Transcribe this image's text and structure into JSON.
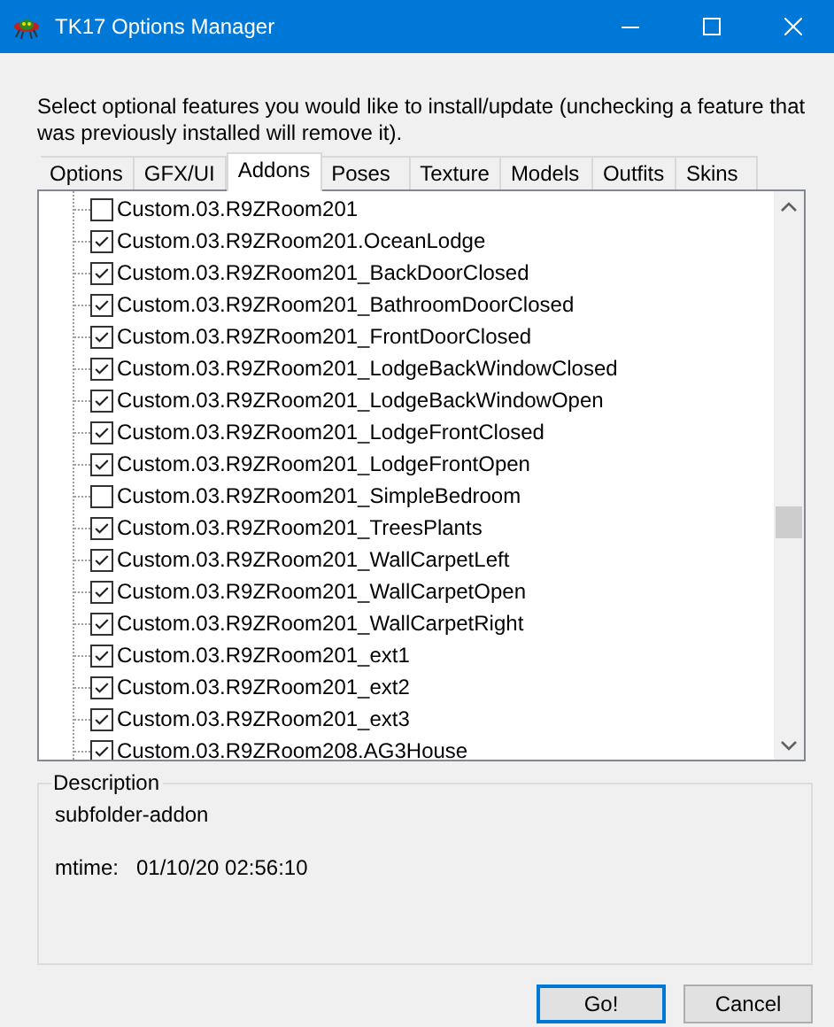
{
  "window": {
    "title": "TK17 Options Manager"
  },
  "instructions": "Select optional features you would like to install/update (unchecking a feature that was previously installed will remove it).",
  "tabs": [
    {
      "label": "Options",
      "selected": false
    },
    {
      "label": "GFX/UI",
      "selected": false
    },
    {
      "label": "Addons",
      "selected": true
    },
    {
      "label": "Poses",
      "selected": false
    },
    {
      "label": "Texture",
      "selected": false
    },
    {
      "label": "Models",
      "selected": false
    },
    {
      "label": "Outfits",
      "selected": false
    },
    {
      "label": "Skins",
      "selected": false
    }
  ],
  "tree": {
    "items": [
      {
        "label": "Custom.03.R9ZRoom201",
        "checked": false
      },
      {
        "label": "Custom.03.R9ZRoom201.OceanLodge",
        "checked": true
      },
      {
        "label": "Custom.03.R9ZRoom201_BackDoorClosed",
        "checked": true
      },
      {
        "label": "Custom.03.R9ZRoom201_BathroomDoorClosed",
        "checked": true
      },
      {
        "label": "Custom.03.R9ZRoom201_FrontDoorClosed",
        "checked": true
      },
      {
        "label": "Custom.03.R9ZRoom201_LodgeBackWindowClosed",
        "checked": true
      },
      {
        "label": "Custom.03.R9ZRoom201_LodgeBackWindowOpen",
        "checked": true
      },
      {
        "label": "Custom.03.R9ZRoom201_LodgeFrontClosed",
        "checked": true
      },
      {
        "label": "Custom.03.R9ZRoom201_LodgeFrontOpen",
        "checked": true
      },
      {
        "label": "Custom.03.R9ZRoom201_SimpleBedroom",
        "checked": false
      },
      {
        "label": "Custom.03.R9ZRoom201_TreesPlants",
        "checked": true
      },
      {
        "label": "Custom.03.R9ZRoom201_WallCarpetLeft",
        "checked": true
      },
      {
        "label": "Custom.03.R9ZRoom201_WallCarpetOpen",
        "checked": true
      },
      {
        "label": "Custom.03.R9ZRoom201_WallCarpetRight",
        "checked": true
      },
      {
        "label": "Custom.03.R9ZRoom201_ext1",
        "checked": true
      },
      {
        "label": "Custom.03.R9ZRoom201_ext2",
        "checked": true
      },
      {
        "label": "Custom.03.R9ZRoom201_ext3",
        "checked": true
      },
      {
        "label": "Custom.03.R9ZRoom208.AG3House",
        "checked": true
      }
    ]
  },
  "description": {
    "legend": "Description",
    "text": "subfolder-addon",
    "mtime_label": "mtime:",
    "mtime_value": "01/10/20 02:56:10"
  },
  "buttons": [
    {
      "label": "Go!",
      "default": true
    },
    {
      "label": "Cancel",
      "default": false
    }
  ]
}
